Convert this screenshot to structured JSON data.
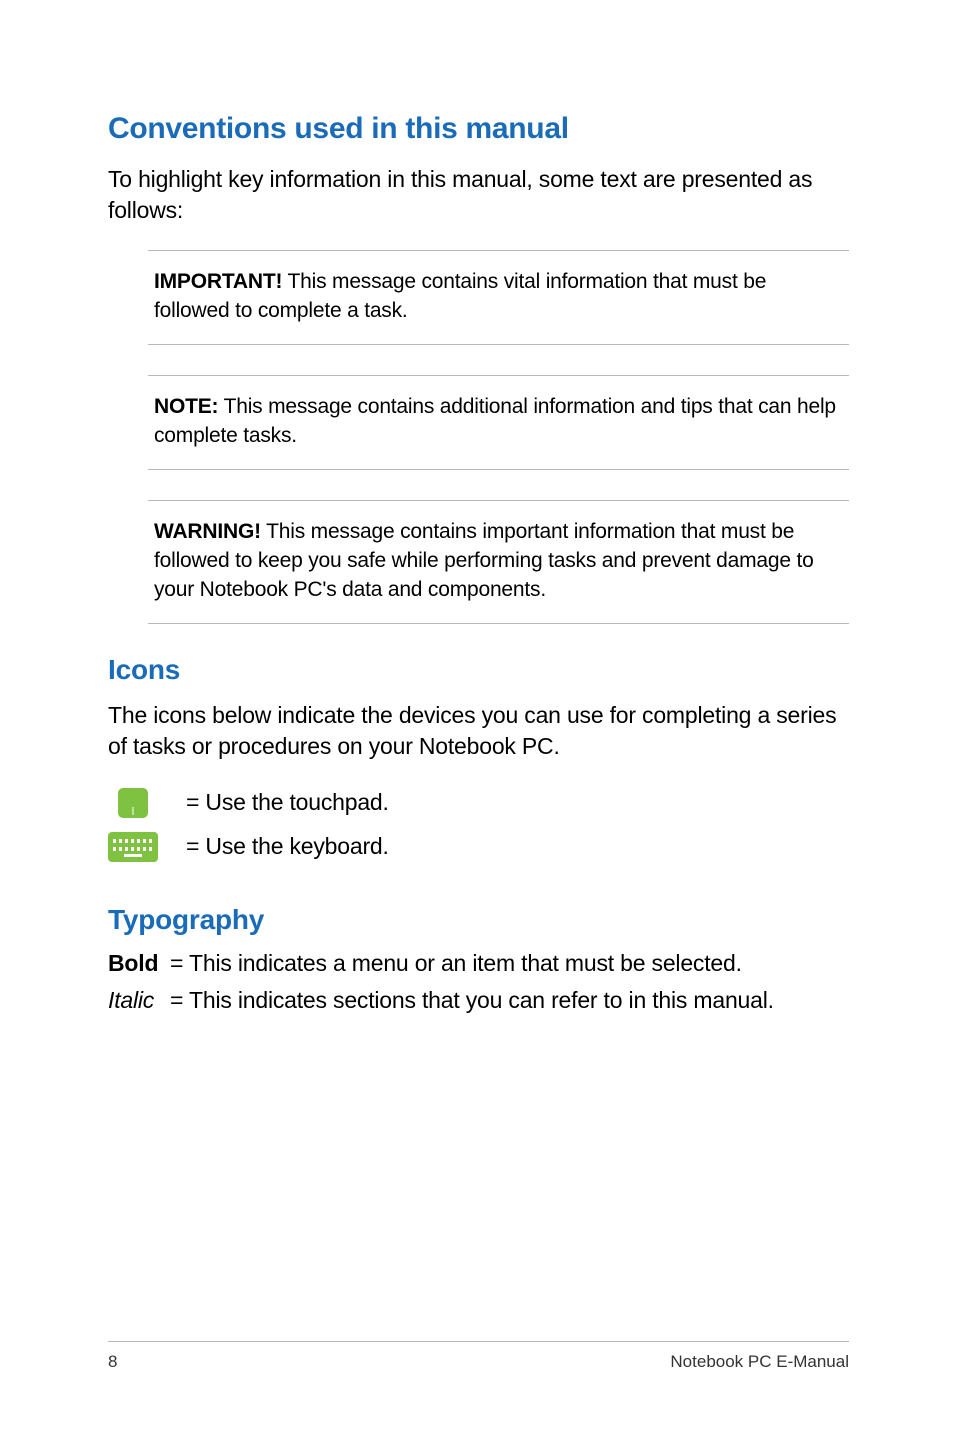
{
  "headings": {
    "conventions": "Conventions used in this manual",
    "icons": "Icons",
    "typography": "Typography"
  },
  "conventions_intro": "To highlight key information in this manual, some text are presented as follows:",
  "callouts": {
    "important_label": "IMPORTANT!",
    "important_text": " This message contains vital information that must be followed to complete a task.",
    "note_label": "NOTE:",
    "note_text": " This message contains additional information and tips that can help complete tasks.",
    "warning_label": "WARNING!",
    "warning_text": " This message contains important information that must be followed to keep you safe while performing tasks and prevent damage to your Notebook PC's data and components."
  },
  "icons_intro": "The icons below indicate the devices you can use for completing a series of tasks or procedures on your Notebook PC.",
  "icon_rows": {
    "touchpad": "= Use the touchpad.",
    "keyboard": "= Use the keyboard."
  },
  "typography": {
    "bold_label": "Bold",
    "bold_desc": "= This indicates a menu or an item that must be selected.",
    "italic_label": "Italic",
    "italic_desc": "= This indicates sections that you can refer to in this manual."
  },
  "footer": {
    "page_number": "8",
    "title": "Notebook PC E-Manual"
  }
}
